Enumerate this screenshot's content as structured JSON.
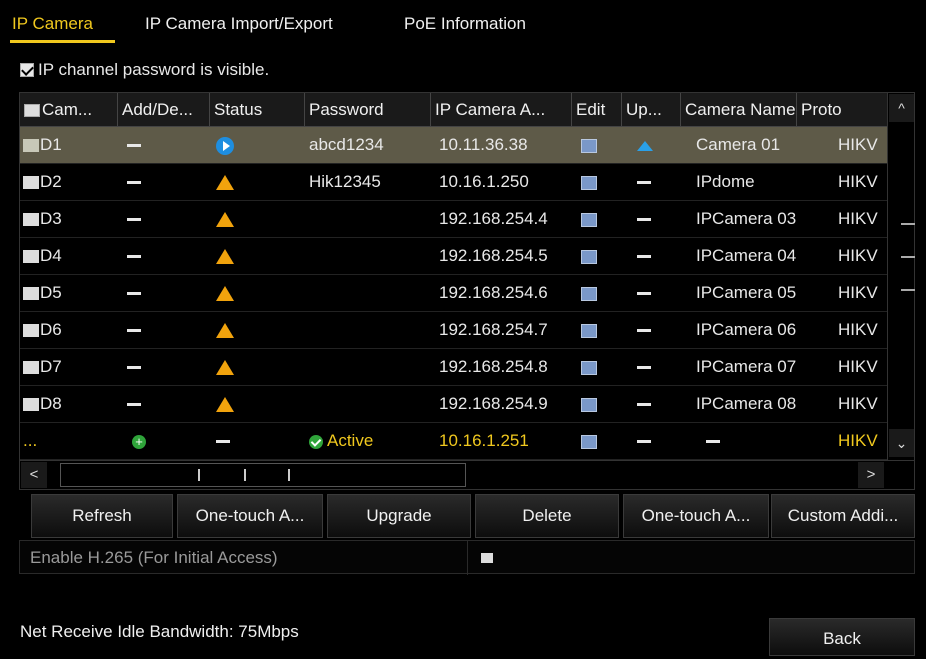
{
  "tabs": [
    "IP Camera",
    "IP Camera Import/Export",
    "PoE Information"
  ],
  "password_visible": {
    "label": "IP channel password is visible.",
    "checked": true
  },
  "table": {
    "headers": [
      "Cam...",
      "Add/De...",
      "Status",
      "Password",
      "IP Camera A...",
      "Edit",
      "Up...",
      "Camera Name",
      "Proto"
    ],
    "rows": [
      {
        "cam": "D1",
        "password": "abcd1234",
        "ip": "10.11.36.38",
        "name": "Camera 01",
        "proto": "HIKV"
      },
      {
        "cam": "D2",
        "password": "Hik12345",
        "ip": "10.16.1.250",
        "name": "IPdome",
        "proto": "HIKV"
      },
      {
        "cam": "D3",
        "password": "",
        "ip": "192.168.254.4",
        "name": "IPCamera 03",
        "proto": "HIKV"
      },
      {
        "cam": "D4",
        "password": "",
        "ip": "192.168.254.5",
        "name": "IPCamera 04",
        "proto": "HIKV"
      },
      {
        "cam": "D5",
        "password": "",
        "ip": "192.168.254.6",
        "name": "IPCamera 05",
        "proto": "HIKV"
      },
      {
        "cam": "D6",
        "password": "",
        "ip": "192.168.254.7",
        "name": "IPCamera 06",
        "proto": "HIKV"
      },
      {
        "cam": "D7",
        "password": "",
        "ip": "192.168.254.8",
        "name": "IPCamera 07",
        "proto": "HIKV"
      },
      {
        "cam": "D8",
        "password": "",
        "ip": "192.168.254.9",
        "name": "IPCamera 08",
        "proto": "HIKV"
      }
    ],
    "last_row": {
      "cam": "...",
      "password": "Active",
      "ip": "10.16.1.251",
      "proto": "HIKV"
    }
  },
  "buttons": [
    "Refresh",
    "One-touch A...",
    "Upgrade",
    "Delete",
    "One-touch A...",
    "Custom Addi..."
  ],
  "h265": {
    "label": "Enable H.265 (For Initial Access)"
  },
  "bandwidth": "Net Receive Idle Bandwidth: 75Mbps",
  "back": "Back",
  "colors": {
    "accent": "#f0c81e",
    "selected_row": "#5e5a48",
    "warning": "#f1a30d",
    "ok": "#2fa43a",
    "play": "#1e8ee0"
  }
}
